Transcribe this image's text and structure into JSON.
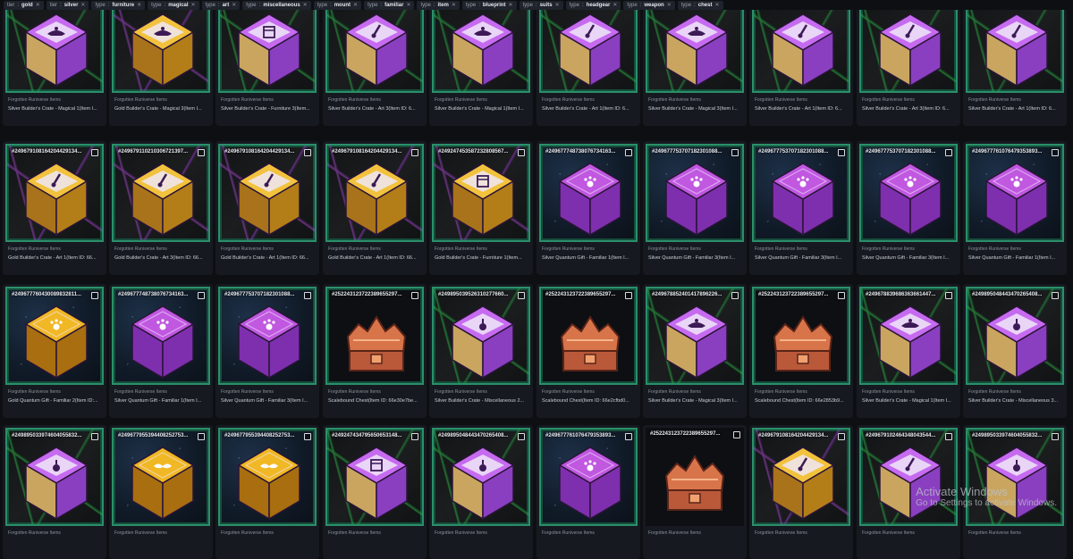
{
  "filters": [
    {
      "key": "tier",
      "value": "gold"
    },
    {
      "key": "tier",
      "value": "silver"
    },
    {
      "key": "type",
      "value": "furniture"
    },
    {
      "key": "type",
      "value": "magical"
    },
    {
      "key": "type",
      "value": "art"
    },
    {
      "key": "type",
      "value": "miscellaneous"
    },
    {
      "key": "type",
      "value": "mount"
    },
    {
      "key": "type",
      "value": "familiar"
    },
    {
      "key": "type",
      "value": "item"
    },
    {
      "key": "type",
      "value": "blueprint"
    },
    {
      "key": "type",
      "value": "suits"
    },
    {
      "key": "type",
      "value": "headgear"
    },
    {
      "key": "type",
      "value": "weapon"
    },
    {
      "key": "type",
      "value": "chest"
    }
  ],
  "colors": {
    "silver_top": "#c66bf0",
    "silver_side": "#8a3fc0",
    "gold_top": "#f2c23c",
    "gold_side": "#b37d18",
    "quantum_purple": "#c058e0",
    "quantum_gold": "#f0b824",
    "chest": "#d8744a",
    "frame": "#2b8f6a"
  },
  "watermark": {
    "line1": "Activate Windows",
    "line2": "Go to Settings to activate Windows."
  },
  "cards": [
    {
      "id": "",
      "collection": "Forgotten Runiverse Items",
      "name": "Silver Builder's Crate - Magical 1(Item I...",
      "kind": "silver",
      "icon": "lamp",
      "bg": "green"
    },
    {
      "id": "",
      "collection": "Forgotten Runiverse Items",
      "name": "Gold Builder's Crate - Magical 3(Item I...",
      "kind": "gold",
      "icon": "lamp",
      "bg": "purple"
    },
    {
      "id": "",
      "collection": "Forgotten Runiverse Items",
      "name": "Silver Builder's Crate - Furniture 3(Item...",
      "kind": "silver",
      "icon": "cabinet",
      "bg": "green"
    },
    {
      "id": "",
      "collection": "Forgotten Runiverse Items",
      "name": "Silver Builder's Crate - Art 3(Item ID: 6...",
      "kind": "silver",
      "icon": "brush",
      "bg": "green"
    },
    {
      "id": "",
      "collection": "Forgotten Runiverse Items",
      "name": "Silver Builder's Crate - Magical 1(Item I...",
      "kind": "silver",
      "icon": "lamp",
      "bg": "green"
    },
    {
      "id": "",
      "collection": "Forgotten Runiverse Items",
      "name": "Silver Builder's Crate - Art 1(Item ID: 6...",
      "kind": "silver",
      "icon": "brush",
      "bg": "green"
    },
    {
      "id": "",
      "collection": "Forgotten Runiverse Items",
      "name": "Silver Builder's Crate - Magical 3(Item I...",
      "kind": "silver",
      "icon": "lamp",
      "bg": "green"
    },
    {
      "id": "",
      "collection": "Forgotten Runiverse Items",
      "name": "Silver Builder's Crate - Art 1(Item ID: 6...",
      "kind": "silver",
      "icon": "brush",
      "bg": "green"
    },
    {
      "id": "",
      "collection": "Forgotten Runiverse Items",
      "name": "Silver Builder's Crate - Art 3(Item ID: 6...",
      "kind": "silver",
      "icon": "brush",
      "bg": "green"
    },
    {
      "id": "",
      "collection": "Forgotten Runiverse Items",
      "name": "Silver Builder's Crate - Art 1(Item ID: 6...",
      "kind": "silver",
      "icon": "brush",
      "bg": "green"
    },
    {
      "id": "#249679108164204429134...",
      "collection": "Forgotten Runiverse Items",
      "name": "Gold Builder's Crate - Art 1(Item ID: 66...",
      "kind": "gold",
      "icon": "brush",
      "bg": "purple"
    },
    {
      "id": "#249679110210306721397...",
      "collection": "Forgotten Runiverse Items",
      "name": "Gold Builder's Crate - Art 3(Item ID: 66...",
      "kind": "gold",
      "icon": "brush",
      "bg": "purple"
    },
    {
      "id": "#249679108164204429134...",
      "collection": "Forgotten Runiverse Items",
      "name": "Gold Builder's Crate - Art 1(Item ID: 66...",
      "kind": "gold",
      "icon": "brush",
      "bg": "purple"
    },
    {
      "id": "#249679108164204429134...",
      "collection": "Forgotten Runiverse Items",
      "name": "Gold Builder's Crate - Art 1(Item ID: 66...",
      "kind": "gold",
      "icon": "brush",
      "bg": "purple"
    },
    {
      "id": "#249247453587232808567...",
      "collection": "Forgotten Runiverse Items",
      "name": "Gold Builder's Crate - Furniture 1(Item...",
      "kind": "gold",
      "icon": "cabinet",
      "bg": "purple"
    },
    {
      "id": "#249677748738076734163...",
      "collection": "Forgotten Runiverse Items",
      "name": "Silver Quantum Gift - Familiar 1(Item I...",
      "kind": "qpurple",
      "icon": "paw",
      "bg": "space"
    },
    {
      "id": "#249677753707182301088...",
      "collection": "Forgotten Runiverse Items",
      "name": "Silver Quantum Gift - Familiar 3(Item I...",
      "kind": "qpurple",
      "icon": "paw",
      "bg": "space"
    },
    {
      "id": "#249677753707182301088...",
      "collection": "Forgotten Runiverse Items",
      "name": "Silver Quantum Gift - Familiar 3(Item I...",
      "kind": "qpurple",
      "icon": "paw",
      "bg": "space"
    },
    {
      "id": "#249677753707182301088...",
      "collection": "Forgotten Runiverse Items",
      "name": "Silver Quantum Gift - Familiar 3(Item I...",
      "kind": "qpurple",
      "icon": "paw",
      "bg": "space"
    },
    {
      "id": "#249677761076479353893...",
      "collection": "Forgotten Runiverse Items",
      "name": "Silver Quantum Gift - Familiar 1(Item I...",
      "kind": "qpurple",
      "icon": "paw",
      "bg": "space"
    },
    {
      "id": "#249677760430089832811...",
      "collection": "Forgotten Runiverse Items",
      "name": "Gold Quantum Gift - Familiar 2(Item ID:...",
      "kind": "qgold",
      "icon": "paw",
      "bg": "space"
    },
    {
      "id": "#249677748738076734163...",
      "collection": "Forgotten Runiverse Items",
      "name": "Silver Quantum Gift - Familiar 1(Item I...",
      "kind": "qpurple",
      "icon": "paw",
      "bg": "space"
    },
    {
      "id": "#249677753707182301088...",
      "collection": "Forgotten Runiverse Items",
      "name": "Silver Quantum Gift - Familiar 3(Item I...",
      "kind": "qpurple",
      "icon": "paw",
      "bg": "space"
    },
    {
      "id": "#252243123722389655297...",
      "collection": "Forgotten Runiverse Items",
      "name": "Scalebound Chest(Item ID: 66e30e7be...",
      "kind": "chest",
      "icon": "none",
      "bg": "none"
    },
    {
      "id": "#249895039526310277660...",
      "collection": "Forgotten Runiverse Items",
      "name": "Silver Builder's Crate - Miscellaneous 2...",
      "kind": "silver",
      "icon": "potion",
      "bg": "green"
    },
    {
      "id": "#252243123722389655297...",
      "collection": "Forgotten Runiverse Items",
      "name": "Scalebound Chest(Item ID: 66e2cfbd0...",
      "kind": "chest",
      "icon": "none",
      "bg": "none"
    },
    {
      "id": "#249678852401417896226...",
      "collection": "Forgotten Runiverse Items",
      "name": "Silver Builder's Crate - Magical 3(Item I...",
      "kind": "silver",
      "icon": "lamp",
      "bg": "green"
    },
    {
      "id": "#252243123722389655297...",
      "collection": "Forgotten Runiverse Items",
      "name": "Scalebound Chest(Item ID: 66e2853b9...",
      "kind": "chest",
      "icon": "none",
      "bg": "none"
    },
    {
      "id": "#249678839686363661447...",
      "collection": "Forgotten Runiverse Items",
      "name": "Silver Builder's Crate - Magical 1(Item I...",
      "kind": "silver",
      "icon": "lamp",
      "bg": "green"
    },
    {
      "id": "#249895048443470265408...",
      "collection": "Forgotten Runiverse Items",
      "name": "Silver Builder's Crate - Miscellaneous 3...",
      "kind": "silver",
      "icon": "potion",
      "bg": "green"
    },
    {
      "id": "#249895033974604055832...",
      "collection": "Forgotten Runiverse Items",
      "name": "",
      "kind": "silver",
      "icon": "potion",
      "bg": "green"
    },
    {
      "id": "#249677955394408252753...",
      "collection": "Forgotten Runiverse Items",
      "name": "",
      "kind": "qgold",
      "icon": "mustache",
      "bg": "space"
    },
    {
      "id": "#249677955394408252753...",
      "collection": "Forgotten Runiverse Items",
      "name": "",
      "kind": "qgold",
      "icon": "mustache",
      "bg": "space"
    },
    {
      "id": "#249247434795650653148...",
      "collection": "Forgotten Runiverse Items",
      "name": "",
      "kind": "silver",
      "icon": "cabinet",
      "bg": "green"
    },
    {
      "id": "#249895048443470265408...",
      "collection": "Forgotten Runiverse Items",
      "name": "",
      "kind": "silver",
      "icon": "potion",
      "bg": "green"
    },
    {
      "id": "#249677761076479353893...",
      "collection": "Forgotten Runiverse Items",
      "name": "",
      "kind": "qpurple",
      "icon": "paw",
      "bg": "space"
    },
    {
      "id": "#252243123722389655297...",
      "collection": "Forgotten Runiverse Items",
      "name": "",
      "kind": "chest",
      "icon": "none",
      "bg": "none"
    },
    {
      "id": "#249679108164204429134...",
      "collection": "Forgotten Runiverse Items",
      "name": "",
      "kind": "gold",
      "icon": "brush",
      "bg": "purple"
    },
    {
      "id": "#249679102464348043544...",
      "collection": "Forgotten Runiverse Items",
      "name": "",
      "kind": "silver",
      "icon": "brush",
      "bg": "green"
    },
    {
      "id": "#249895033974604055832...",
      "collection": "Forgotten Runiverse Items",
      "name": "",
      "kind": "silver",
      "icon": "potion",
      "bg": "green"
    }
  ]
}
